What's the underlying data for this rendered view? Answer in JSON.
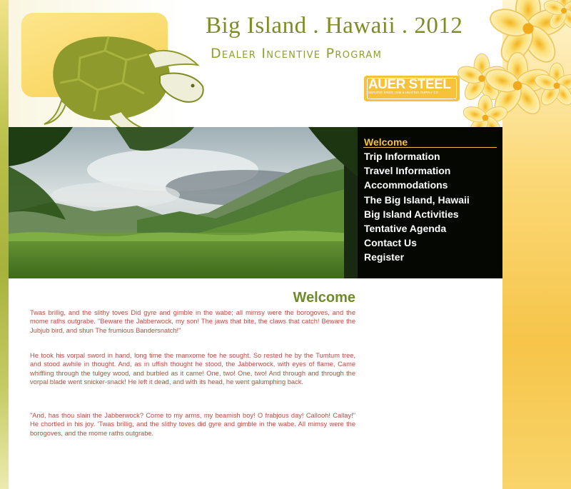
{
  "header": {
    "title": "Big Island . Hawaii . 2012",
    "subtitle": "Dealer Incentive Program",
    "logo": {
      "name": "AUER STEEL",
      "tagline": "SERVING SINCE 1946  &  HEATING SUPPLY CO."
    }
  },
  "nav": {
    "items": [
      {
        "label": "Welcome",
        "active": true
      },
      {
        "label": "Trip Information"
      },
      {
        "label": "Travel Information"
      },
      {
        "label": "Accommodations"
      },
      {
        "label": "The Big Island, Hawaii"
      },
      {
        "label": "Big Island Activities"
      },
      {
        "label": "Tentative Agenda"
      },
      {
        "label": "Contact Us"
      },
      {
        "label": "Register"
      }
    ]
  },
  "main": {
    "title": "Welcome",
    "paragraphs": [
      "Twas brillig, and the slithy toves Did gyre and gimble in the wabe; all mimsy were the borogoves, and the mome raths outgrabe. \"Beware the Jabberwock, my son! The jaws that bite, the claws that catch! Beware the Jubjub bird, and shun The frumious Bandersnatch!\"",
      "He took his vorpal sword in hand, long time the manxome foe he sought. So rested he by the Tumtum tree, and stood awhile in thought. And, as in uffish thought he stood, the Jabberwock, with eyes of flame, Came whiffling through the tulgey wood, and burbled as it came!  One, two! One, two! And through and through the vorpal blade went snicker-snack! He left it dead, and with its head, he went galumphing back.",
      "\"And, has thou slain the Jabberwock? Come to my arms, my beamish boy! O frabjous day! Callooh! Callay!\" He chortled in his joy. 'Twas brillig, and the slithy toves did gyre and gimble in the wabe.  All mimsy were the borogoves, and the mome raths outgrabe."
    ]
  },
  "colors": {
    "title_green": "#7f8c25",
    "nav_active": "#f6c23b",
    "body_text": "#b54c3f",
    "content_heading": "#6f8a2a"
  },
  "icons": [
    "turtle-icon",
    "plumeria-flower-icon"
  ]
}
